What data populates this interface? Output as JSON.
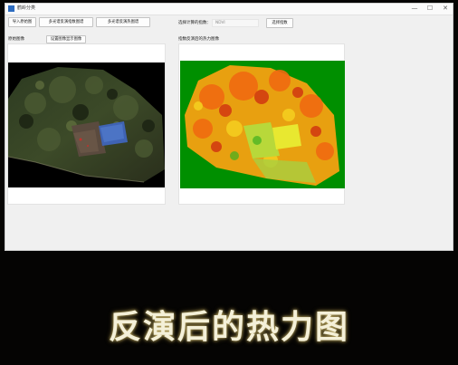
{
  "window": {
    "title": "鹤岭分类",
    "controls": [
      "—",
      "☐",
      "✕"
    ]
  },
  "toolbar": {
    "import_button": "导入原始图",
    "first_button": "多光谱反演指数图谱",
    "second_button": "多光谱反演热图谱",
    "index_label": "选择计算的指数：",
    "index_value": "NDVI",
    "open_button": "选择指数"
  },
  "left_panel": {
    "title": "原始图像",
    "button": "设置图像显示图像"
  },
  "right_panel": {
    "title": "指数反演后的热力图像"
  },
  "caption": "反演后的热力图"
}
